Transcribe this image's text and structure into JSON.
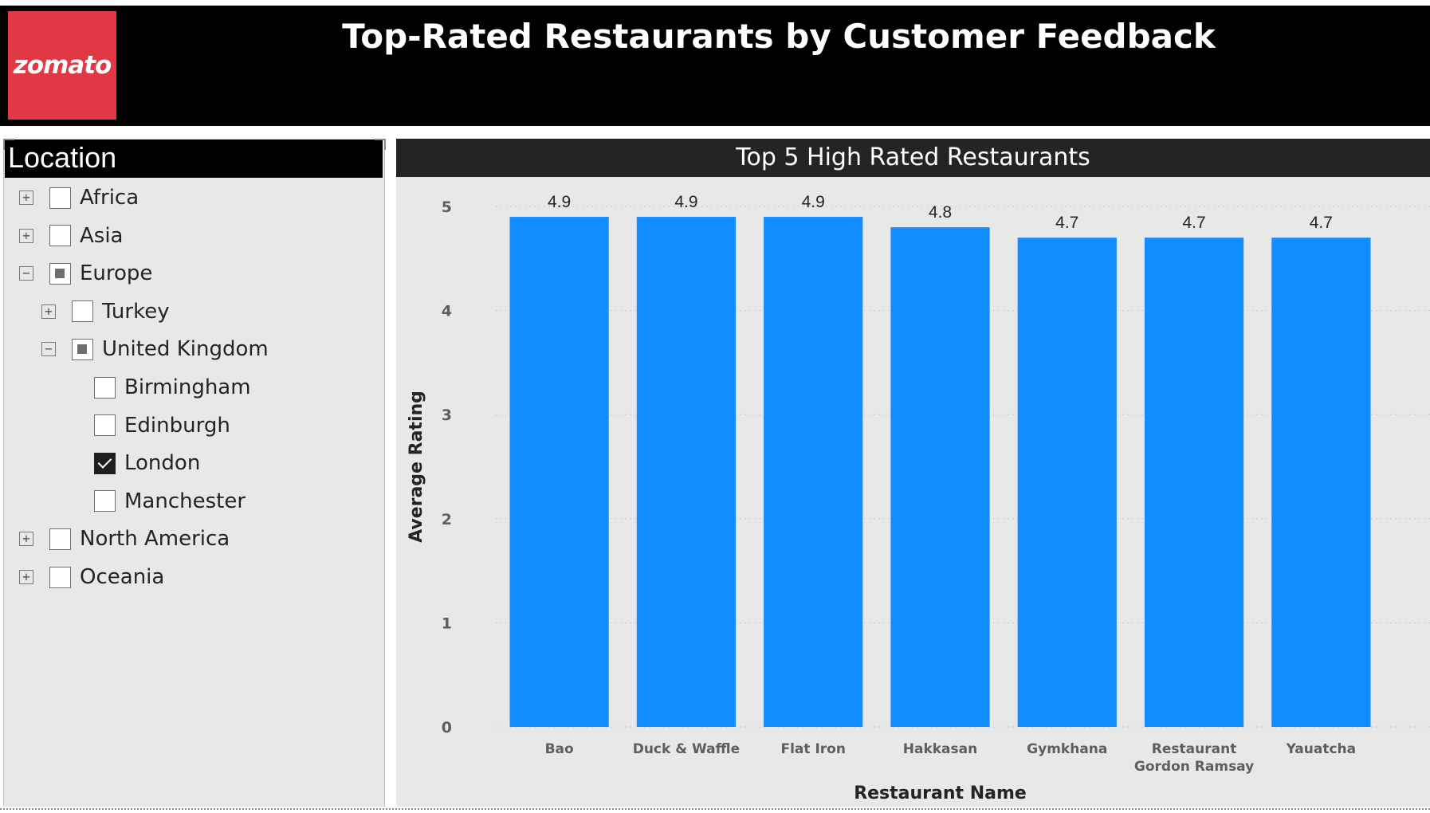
{
  "header": {
    "logo_text": "zomato",
    "title": "Top-Rated Restaurants by Customer Feedback",
    "colors": {
      "background": "#000000",
      "logo_bg": "#e23744"
    }
  },
  "slicer": {
    "title": "Location",
    "items": [
      {
        "label": "Africa",
        "level": 0,
        "expander": "+",
        "state": "unchecked"
      },
      {
        "label": "Asia",
        "level": 0,
        "expander": "+",
        "state": "unchecked"
      },
      {
        "label": "Europe",
        "level": 0,
        "expander": "−",
        "state": "partial"
      },
      {
        "label": "Turkey",
        "level": 1,
        "expander": "+",
        "state": "unchecked"
      },
      {
        "label": "United Kingdom",
        "level": 1,
        "expander": "−",
        "state": "partial"
      },
      {
        "label": "Birmingham",
        "level": 2,
        "expander": "",
        "state": "unchecked"
      },
      {
        "label": "Edinburgh",
        "level": 2,
        "expander": "",
        "state": "unchecked"
      },
      {
        "label": "London",
        "level": 2,
        "expander": "",
        "state": "checked"
      },
      {
        "label": "Manchester",
        "level": 2,
        "expander": "",
        "state": "unchecked"
      },
      {
        "label": "North America",
        "level": 0,
        "expander": "+",
        "state": "unchecked"
      },
      {
        "label": "Oceania",
        "level": 0,
        "expander": "+",
        "state": "unchecked"
      }
    ]
  },
  "chart": {
    "title": "Top 5 High Rated Restaurants"
  },
  "chart_data": {
    "type": "bar",
    "title": "Top 5 High Rated Restaurants",
    "xlabel": "Restaurant Name",
    "ylabel": "Average Rating",
    "categories": [
      [
        "Bao"
      ],
      [
        "Duck & Waffle"
      ],
      [
        "Flat Iron"
      ],
      [
        "Hakkasan"
      ],
      [
        "Gymkhana"
      ],
      [
        "Restaurant",
        "Gordon Ramsay"
      ],
      [
        "Yauatcha"
      ]
    ],
    "values": [
      4.9,
      4.9,
      4.9,
      4.8,
      4.7,
      4.7,
      4.7
    ],
    "data_labels": [
      "4.9",
      "4.9",
      "4.9",
      "4.8",
      "4.7",
      "4.7",
      "4.7"
    ],
    "ylim": [
      0,
      5
    ],
    "yticks": [
      0,
      1,
      2,
      3,
      4,
      5
    ],
    "grid": true,
    "bar_color": "#118dff"
  }
}
